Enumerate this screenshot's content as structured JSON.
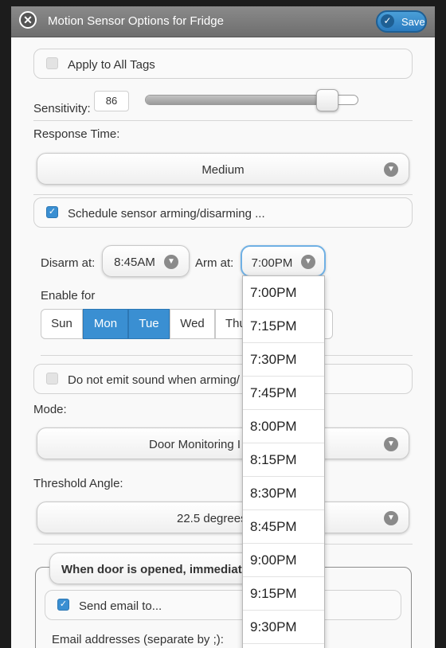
{
  "dialog": {
    "title": "Motion Sensor Options for Fridge",
    "save_label": "Save"
  },
  "apply_all": {
    "label": "Apply to All Tags",
    "checked": false
  },
  "sensitivity": {
    "label": "Sensitivity:",
    "value": "86",
    "level_percent": 86
  },
  "response_time": {
    "label": "Response Time:",
    "value": "Medium"
  },
  "schedule": {
    "label": "Schedule sensor arming/disarming ...",
    "checked": true
  },
  "disarm": {
    "label": "Disarm at:",
    "value": "8:45AM"
  },
  "arm": {
    "label": "Arm at:",
    "value": "7:00PM"
  },
  "enable_for": {
    "label": "Enable for",
    "days": [
      {
        "label": "Sun",
        "selected": false
      },
      {
        "label": "Mon",
        "selected": true
      },
      {
        "label": "Tue",
        "selected": true
      },
      {
        "label": "Wed",
        "selected": false
      },
      {
        "label": "Thu",
        "selected": false
      }
    ]
  },
  "no_sound": {
    "label": "Do not emit sound when arming/",
    "checked": false
  },
  "mode": {
    "label": "Mode:",
    "value": "Door Monitoring I"
  },
  "threshold": {
    "label": "Threshold Angle:",
    "value": "22.5 degrees"
  },
  "door_action": {
    "label": "When door is opened, immediately"
  },
  "send_email": {
    "label": "Send email to...",
    "checked": true
  },
  "email_addresses": {
    "label": "Email addresses (separate by ;):"
  },
  "time_options": [
    "7:00PM",
    "7:15PM",
    "7:30PM",
    "7:45PM",
    "8:00PM",
    "8:15PM",
    "8:30PM",
    "8:45PM",
    "9:00PM",
    "9:15PM",
    "9:30PM"
  ],
  "colors": {
    "accent": "#3a8fd2",
    "header": "#7a7a7a"
  }
}
